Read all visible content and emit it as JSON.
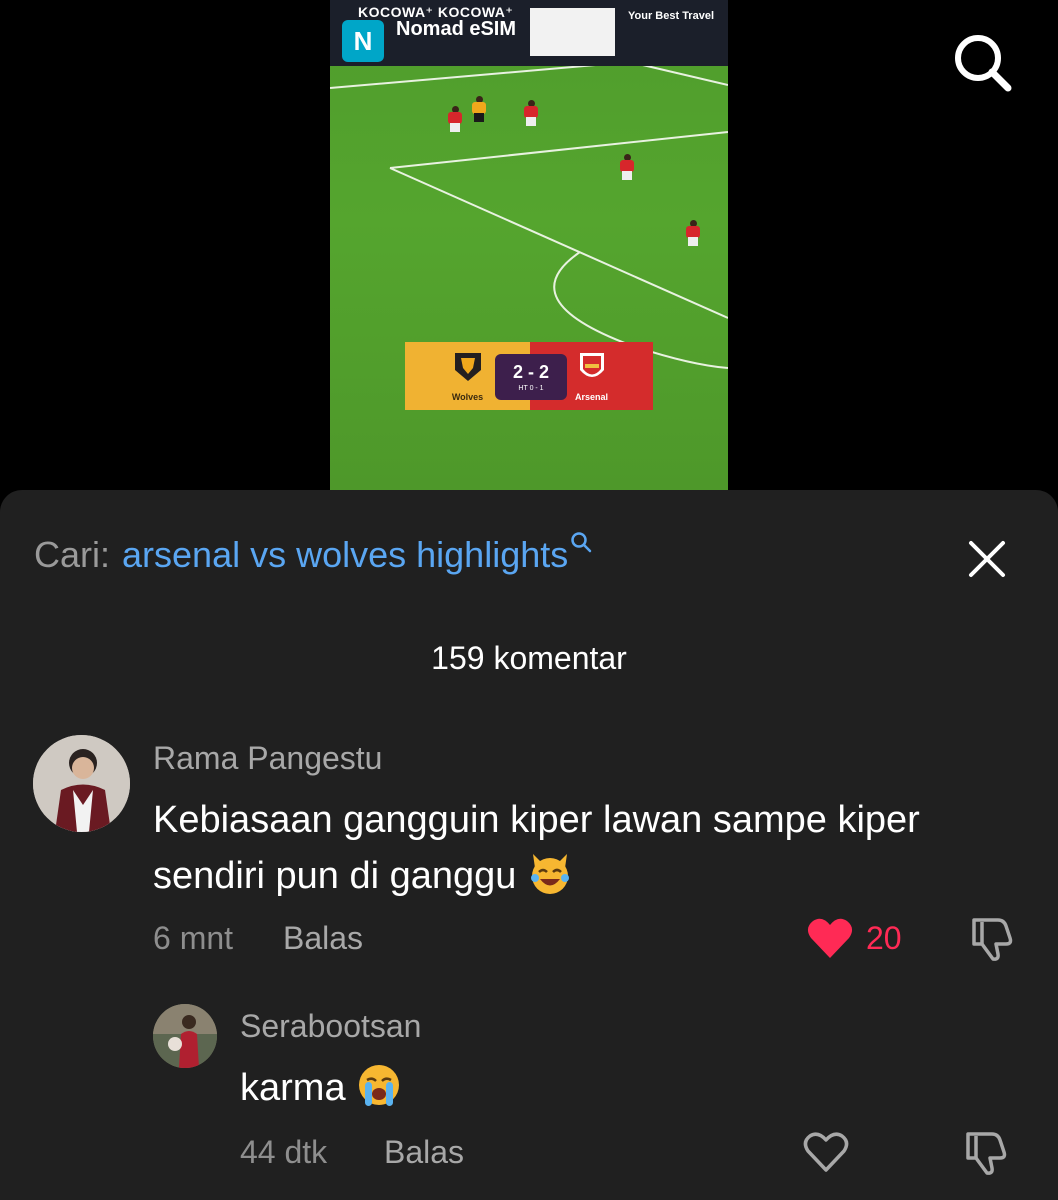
{
  "video": {
    "ad_kocowa": "KOCOWA⁺   KOCOWA⁺",
    "ad_nomad": "Nomad eSIM",
    "ad_travel": "Your Best Travel",
    "home_team": "Wolves",
    "away_team": "Arsenal",
    "score": "2 - 2",
    "halftime": "HT 0 - 1"
  },
  "search": {
    "prefix": "Cari:",
    "query": "arsenal vs wolves highlights"
  },
  "comments_count": "159 komentar",
  "comments": [
    {
      "username": "Rama Pangestu",
      "text_line1": "Kebiasaan gangguin kiper lawan sampe kiper",
      "text_line2": "sendiri pun di ganggu",
      "time": "6 mnt",
      "reply": "Balas",
      "likes": "20",
      "liked": true
    },
    {
      "username": "Serabootsan",
      "text": "karma",
      "time": "44 dtk",
      "reply": "Balas",
      "liked": false
    }
  ],
  "colors": {
    "sheet_bg": "#202020",
    "link_blue": "#5aa6f2",
    "like_red": "#ff2a55"
  }
}
